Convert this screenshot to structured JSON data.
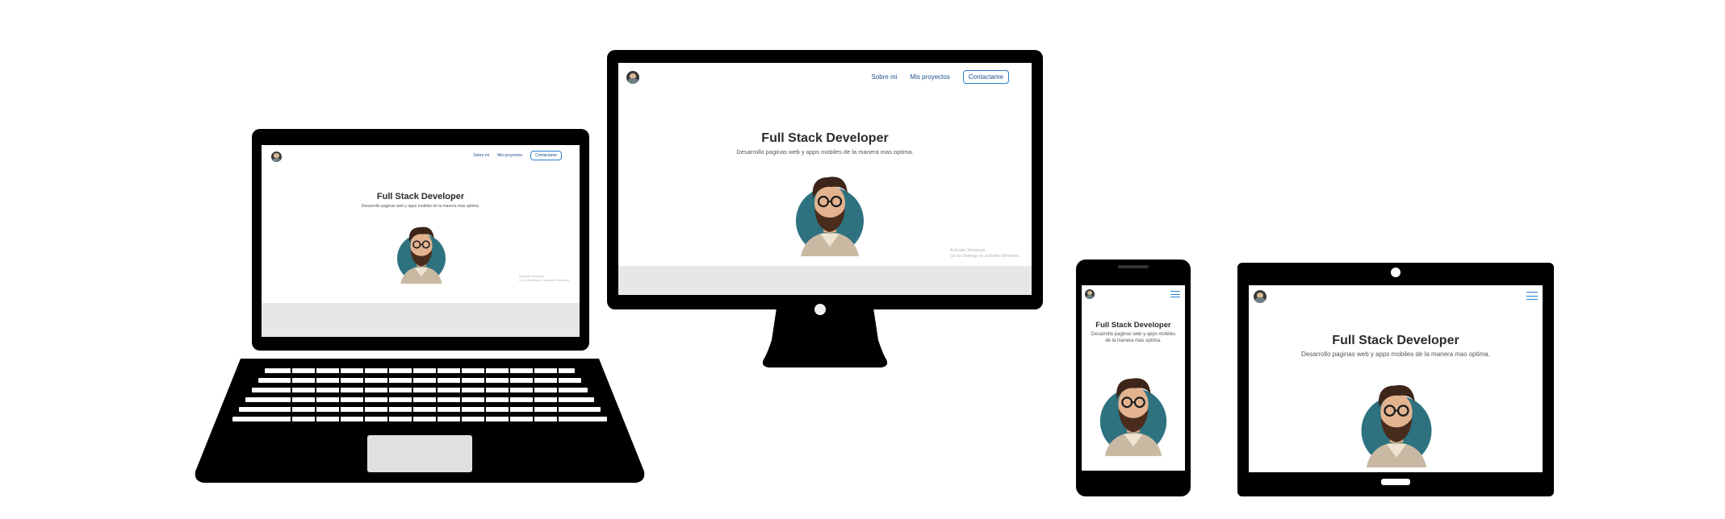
{
  "site": {
    "nav": {
      "about": "Sobre mi",
      "projects": "Mis proyectos",
      "contact": "Contactame"
    },
    "hero": {
      "title": "Full Stack Developer",
      "subtitle": "Desarrollo paginas web y apps mobiles de la manera mas optima.",
      "subtitle_phone": "Desarrollo paginas web y apps mobiles de la manera mas optima."
    },
    "corner_note": {
      "line1": "Activate Windows",
      "line2": "Go to Settings to activate Windows."
    }
  },
  "icons": {
    "avatar": "bearded-developer-avatar",
    "menu": "hamburger-menu-icon"
  },
  "colors": {
    "background": "#ffffff",
    "device_frame": "#000000",
    "accent": "#2d7fd0",
    "avatar_circle": "#2e7280",
    "footer_band": "#e7e7e7"
  }
}
